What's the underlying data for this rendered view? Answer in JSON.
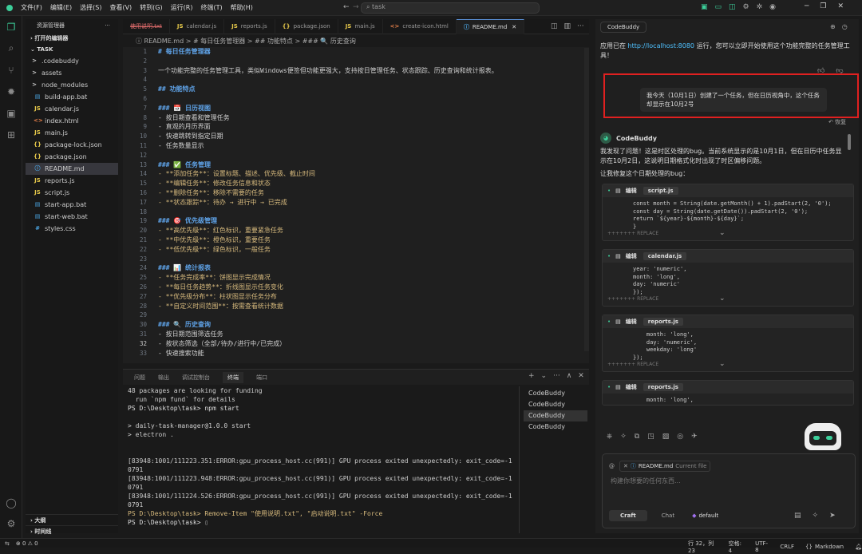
{
  "menubar": {
    "items": [
      "文件(F)",
      "编辑(E)",
      "选择(S)",
      "查看(V)",
      "转到(G)",
      "运行(R)",
      "终端(T)",
      "帮助(H)"
    ],
    "search": "task"
  },
  "sidebar": {
    "title": "资源管理器",
    "open_editors": "打开的编辑器",
    "root": "TASK",
    "items": [
      {
        "label": ".codebuddy",
        "icon": ">",
        "color": "#ccc"
      },
      {
        "label": "assets",
        "icon": ">",
        "color": "#ccc"
      },
      {
        "label": "node_modules",
        "icon": ">",
        "color": "#ccc"
      },
      {
        "label": "build-app.bat",
        "icon": "▤",
        "color": "#4aa3df"
      },
      {
        "label": "calendar.js",
        "icon": "JS",
        "color": "#e6c84a"
      },
      {
        "label": "index.html",
        "icon": "<>",
        "color": "#e8804a"
      },
      {
        "label": "main.js",
        "icon": "JS",
        "color": "#e6c84a"
      },
      {
        "label": "package-lock.json",
        "icon": "{}",
        "color": "#e6c84a"
      },
      {
        "label": "package.json",
        "icon": "{}",
        "color": "#e6c84a"
      },
      {
        "label": "README.md",
        "icon": "ⓘ",
        "color": "#4aa3df"
      },
      {
        "label": "reports.js",
        "icon": "JS",
        "color": "#e6c84a"
      },
      {
        "label": "script.js",
        "icon": "JS",
        "color": "#e6c84a"
      },
      {
        "label": "start-app.bat",
        "icon": "▤",
        "color": "#4aa3df"
      },
      {
        "label": "start-web.bat",
        "icon": "▤",
        "color": "#4aa3df"
      },
      {
        "label": "styles.css",
        "icon": "#",
        "color": "#4aa3df"
      }
    ],
    "outline": "大纲",
    "timeline": "时间线"
  },
  "tabs": [
    {
      "label": "使用说明.txt",
      "icon": "",
      "color": "#e06c6c"
    },
    {
      "label": "calendar.js",
      "icon": "JS",
      "color": "#e6c84a"
    },
    {
      "label": "reports.js",
      "icon": "JS",
      "color": "#e6c84a"
    },
    {
      "label": "package.json",
      "icon": "{}",
      "color": "#e6c84a"
    },
    {
      "label": "main.js",
      "icon": "JS",
      "color": "#e6c84a"
    },
    {
      "label": "create-icon.html",
      "icon": "<>",
      "color": "#e8804a"
    },
    {
      "label": "README.md",
      "icon": "ⓘ",
      "color": "#4aa3df"
    }
  ],
  "breadcrumb": "README.md > # 每日任务管理器 > ## 功能特点 > ### 🔍 历史查询",
  "editor_lines": [
    [
      "1",
      "# 每日任务管理器",
      "h"
    ],
    [
      "2",
      "",
      ""
    ],
    [
      "3",
      "一个功能完整的任务管理工具，类似Windows便签但功能更强大，支持按日管理任务、状态跟踪、历史查询和统计报表。",
      ""
    ],
    [
      "4",
      "",
      ""
    ],
    [
      "5",
      "## 功能特点",
      "h"
    ],
    [
      "6",
      "",
      ""
    ],
    [
      "7",
      "### 📅 日历视图",
      "h"
    ],
    [
      "8",
      "- 按日期查看和管理任务",
      ""
    ],
    [
      "9",
      "- 直观的月历界面",
      ""
    ],
    [
      "10",
      "- 快速跳转到指定日期",
      ""
    ],
    [
      "11",
      "- 任务数量显示",
      ""
    ],
    [
      "12",
      "",
      ""
    ],
    [
      "13",
      "### ✅ 任务管理",
      "h"
    ],
    [
      "14",
      "- **添加任务**：设置标题、描述、优先级、截止时间",
      "b"
    ],
    [
      "15",
      "- **编辑任务**：修改任务信息和状态",
      "b"
    ],
    [
      "16",
      "- **删除任务**：移除不需要的任务",
      "b"
    ],
    [
      "17",
      "- **状态跟踪**：待办 → 进行中 → 已完成",
      "b"
    ],
    [
      "18",
      "",
      ""
    ],
    [
      "19",
      "### 🎯 优先级管理",
      "h"
    ],
    [
      "20",
      "- **高优先级**：红色标识，重要紧急任务",
      "b"
    ],
    [
      "21",
      "- **中优先级**：橙色标识，重要任务",
      "b"
    ],
    [
      "22",
      "- **低优先级**：绿色标识，一般任务",
      "b"
    ],
    [
      "23",
      "",
      ""
    ],
    [
      "24",
      "### 📊 统计报表",
      "h"
    ],
    [
      "25",
      "- **任务完成率**：饼图显示完成情况",
      "b"
    ],
    [
      "26",
      "- **每日任务趋势**：折线图显示任务变化",
      "b"
    ],
    [
      "27",
      "- **优先级分布**：柱状图显示任务分布",
      "b"
    ],
    [
      "28",
      "- **自定义时间范围**：按需查看统计数据",
      "b"
    ],
    [
      "29",
      "",
      ""
    ],
    [
      "30",
      "### 🔍 历史查询",
      "h"
    ],
    [
      "31",
      "- 按日期范围筛选任务",
      ""
    ],
    [
      "32",
      "- 按状态筛选（全部/待办/进行中/已完成）",
      ""
    ],
    [
      "33",
      "- 快速搜索功能",
      ""
    ]
  ],
  "panel_tabs": [
    "问题",
    "输出",
    "调试控制台",
    "终端",
    "端口"
  ],
  "terminal_lines": [
    "48 packages are looking for funding",
    "  run `npm fund` for details",
    "PS D:\\Desktop\\task> npm start",
    "",
    "> daily-task-manager@1.0.0 start",
    "> electron .",
    "",
    "",
    "[83948:1001/111223.351:ERROR:gpu_process_host.cc(991)] GPU process exited unexpectedly: exit_code=-107374",
    "0791",
    "[83948:1001/111223.948:ERROR:gpu_process_host.cc(991)] GPU process exited unexpectedly: exit_code=-107374",
    "0791",
    "[83948:1001/111224.526:ERROR:gpu_process_host.cc(991)] GPU process exited unexpectedly: exit_code=-107374",
    "0791",
    "PS D:\\Desktop\\task> Remove-Item \"使用说明.txt\", \"启动说明.txt\" -Force",
    "PS D:\\Desktop\\task> "
  ],
  "terminal_list": [
    "CodeBuddy",
    "CodeBuddy",
    "CodeBuddy",
    "CodeBuddy"
  ],
  "status": {
    "errors": "⊗ 0 ⚠ 0",
    "position": "行 32，列 23",
    "spaces": "空格: 4",
    "encoding": "UTF-8",
    "eol": "CRLF",
    "lang": "Markdown"
  },
  "chat": {
    "tab": "CodeBuddy",
    "intro_pre": "应用已在 ",
    "intro_link": "http://localhost:8080",
    "intro_post": " 运行，您可以立即开始使用这个功能完整的任务管理工具！",
    "user_msg": "我今天（10月1日）创建了一个任务，但在日历视角中，这个任务却显示在10月2号",
    "revert": "↶ 恢复",
    "assistant": "CodeBuddy",
    "reply1": "我发现了问题！这是时区处理的bug。当前系统显示的是10月1日，但在日历中任务显示在10月2日，这说明日期格式化时出现了时区偏移问题。",
    "reply2": "让我修复这个日期处理的bug：",
    "edit_label": "编辑",
    "replace": "+++++++ REPLACE",
    "cards": [
      {
        "file": "script.js",
        "code": "const month = String(date.getMonth() + 1).padStart(2, '0');\nconst day = String(date.getDate()).padStart(2, '0');\nreturn `${year}-${month}-${day}`;\n}"
      },
      {
        "file": "calendar.js",
        "code": "year: 'numeric',\nmonth: 'long',\nday: 'numeric'\n});"
      },
      {
        "file": "reports.js",
        "code": "    month: 'long',\n    day: 'numeric',\n    weekday: 'long'\n});"
      },
      {
        "file": "reports.js",
        "code": "    month: 'long',"
      }
    ],
    "context_file": "README.md",
    "context_tag": "Current file",
    "placeholder": "构建你想要的任何东西...",
    "mode_craft": "Craft",
    "mode_chat": "Chat",
    "model": "default"
  }
}
